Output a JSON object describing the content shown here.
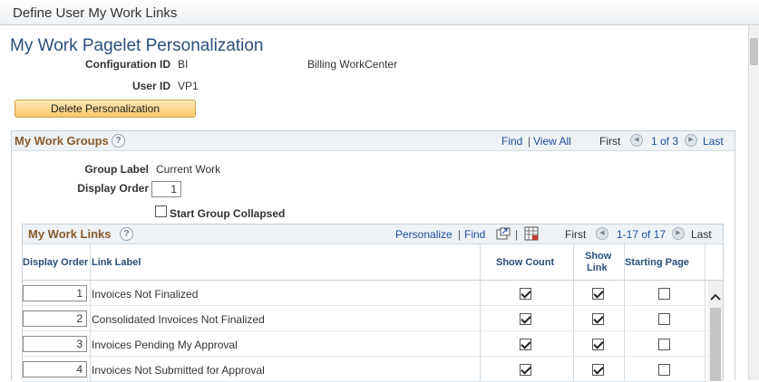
{
  "window": {
    "title": "Define User My Work Links"
  },
  "page": {
    "title": "My Work Pagelet Personalization",
    "config_id_label": "Configuration ID",
    "config_id_value": "BI",
    "config_desc": "Billing WorkCenter",
    "user_id_label": "User ID",
    "user_id_value": "VP1",
    "delete_button": "Delete Personalization"
  },
  "work_groups": {
    "title": "My Work Groups",
    "help": "?",
    "find": "Find",
    "sep": "|",
    "view_all": "View All",
    "first": "First",
    "pos": "1 of 3",
    "last": "Last",
    "group_label_label": "Group Label",
    "group_label_value": "Current Work",
    "display_order_label": "Display Order",
    "display_order_value": "1",
    "start_collapsed_label": "Start Group Collapsed",
    "start_collapsed": false
  },
  "work_links": {
    "title": "My Work Links",
    "help": "?",
    "personalize": "Personalize",
    "sep": "|",
    "find": "Find",
    "first": "First",
    "pos": "1-17 of 17",
    "last": "Last",
    "columns": {
      "display_order": "Display Order",
      "link_label": "Link Label",
      "show_count": "Show Count",
      "show_link_1": "Show",
      "show_link_2": "Link",
      "starting_page": "Starting Page"
    },
    "rows": [
      {
        "order": "1",
        "label": "Invoices Not Finalized",
        "show_count": true,
        "show_link": true,
        "starting_page": false
      },
      {
        "order": "2",
        "label": "Consolidated Invoices Not Finalized",
        "show_count": true,
        "show_link": true,
        "starting_page": false
      },
      {
        "order": "3",
        "label": "Invoices Pending My Approval",
        "show_count": true,
        "show_link": true,
        "starting_page": false
      },
      {
        "order": "4",
        "label": "Invoices Not Submitted for Approval",
        "show_count": true,
        "show_link": true,
        "starting_page": false
      }
    ]
  },
  "icons": {
    "prev": "◀",
    "next": "▶",
    "scroll_up": "^"
  }
}
